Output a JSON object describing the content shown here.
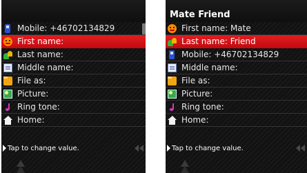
{
  "left_screen": {
    "title": "",
    "fields": [
      {
        "icon": "mobile-phone-icon",
        "label": "Mobile: +46702134829"
      },
      {
        "icon": "face-icon",
        "label": "First name:",
        "selected": true
      },
      {
        "icon": "contacts-icon",
        "label": "Last name:"
      },
      {
        "icon": "document-icon",
        "label": "Middle name:"
      },
      {
        "icon": "folder-icon",
        "label": "File as:"
      },
      {
        "icon": "picture-icon",
        "label": "Picture:"
      },
      {
        "icon": "music-note-icon",
        "label": "Ring tone:"
      },
      {
        "icon": "home-icon",
        "label": "Home:"
      }
    ],
    "hint": "Tap to change value."
  },
  "right_screen": {
    "title": "Mate Friend",
    "fields": [
      {
        "icon": "face-icon",
        "label": "First name: Mate"
      },
      {
        "icon": "contacts-icon",
        "label": "Last name: Friend",
        "selected": true
      },
      {
        "icon": "mobile-phone-icon",
        "label": "Mobile: +46702134829"
      },
      {
        "icon": "document-icon",
        "label": "Middle name:"
      },
      {
        "icon": "folder-icon",
        "label": "File as:"
      },
      {
        "icon": "picture-icon",
        "label": "Picture:"
      },
      {
        "icon": "music-note-icon",
        "label": "Ring tone:"
      },
      {
        "icon": "home-icon",
        "label": "Home:"
      }
    ],
    "hint": "Tap to change value."
  },
  "colors": {
    "selection": "#d9161b",
    "background": "#121212",
    "text": "#e8e8e8"
  }
}
